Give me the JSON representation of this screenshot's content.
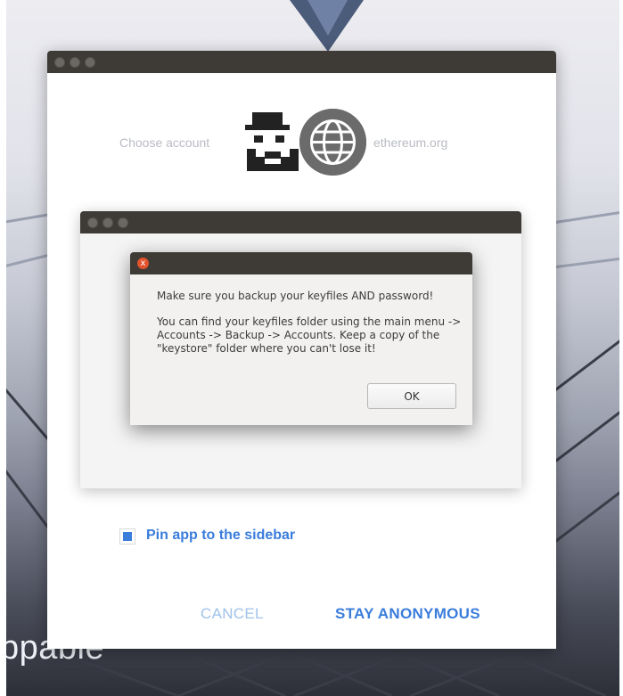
{
  "background": {
    "partial_text": "ppable"
  },
  "main_window": {
    "choose_account_label": "Choose account",
    "site_label": "ethereum.org",
    "pin_checkbox_label": "Pin app to the sidebar",
    "pin_checked": true,
    "cancel_label": "CANCEL",
    "stay_anonymous_label": "STAY ANONYMOUS"
  },
  "dialog": {
    "close_icon": "x",
    "line1": "Make sure you backup your keyfiles AND password!",
    "line2": "You can find your keyfiles folder using the main menu -> Accounts -> Backup -> Accounts. Keep a copy of the \"keystore\" folder where you can't lose it!",
    "ok_label": "OK"
  },
  "colors": {
    "accent": "#3a7ddb",
    "titlebar": "#3e3b37",
    "close": "#e2522c"
  }
}
